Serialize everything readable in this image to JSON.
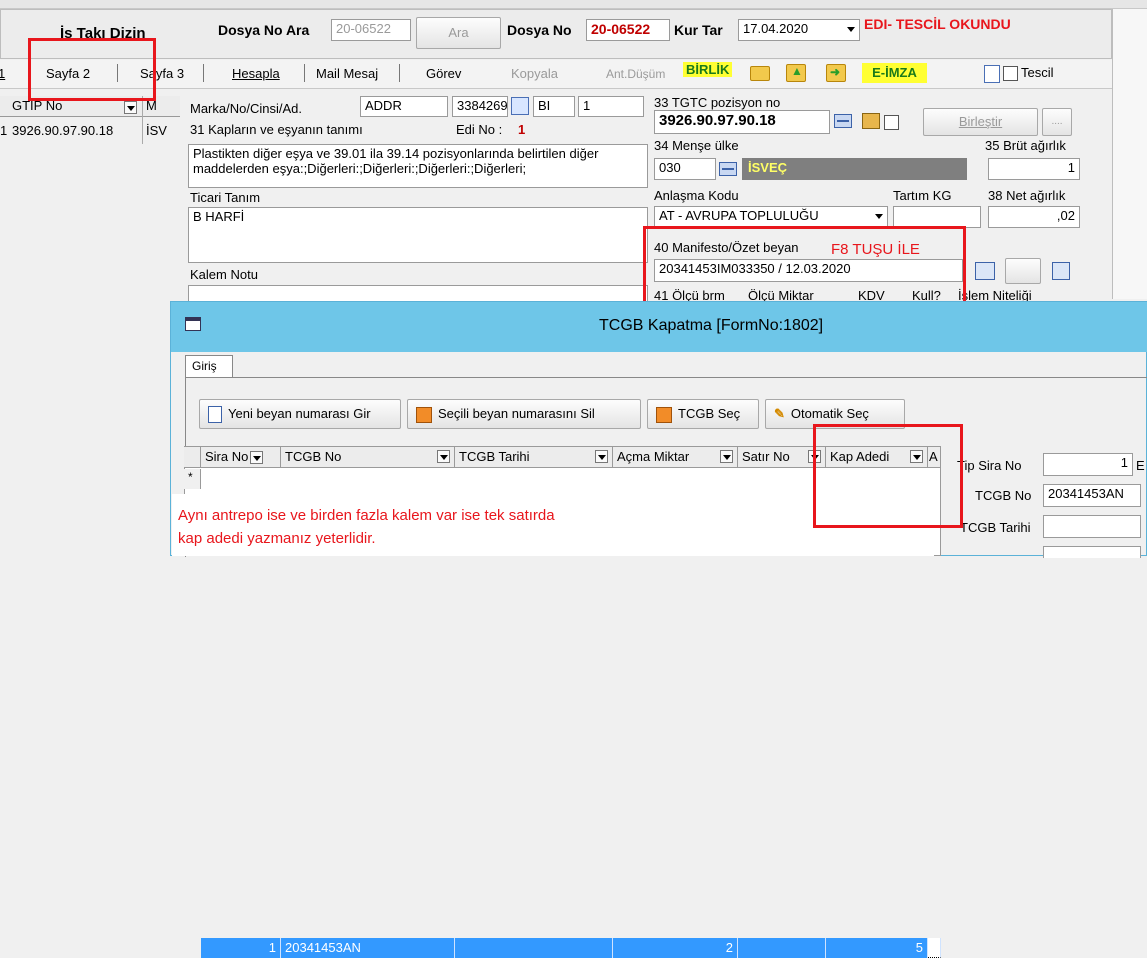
{
  "top": {
    "title_partial": "İş Takı Dizin",
    "dosya_no_ara_label": "Dosya No Ara",
    "dosya_no_ara_value": "20-06522",
    "ara_button": "Ara",
    "dosya_no_label": "Dosya No",
    "dosya_no_value": "20-06522",
    "kur_tar_label": "Kur Tar",
    "kur_tar_value": "17.04.2020",
    "edi_status": "EDI- TESCİL OKUNDU"
  },
  "tabs": [
    "1",
    "Sayfa 2",
    "Sayfa 3",
    "Hesapla",
    "Mail Mesaj",
    "Görev",
    "Kopyala",
    "Ant.Düşüm"
  ],
  "toolbar": {
    "birlik": "BİRLİK",
    "eimza": "E-İMZA",
    "tescil": "Tescil"
  },
  "left_grid": {
    "header": "GTIP No",
    "header2": "M",
    "row_prefix": "1",
    "row_value": "3926.90.97.90.18",
    "row_suffix": "İSV"
  },
  "form": {
    "marka_label": "Marka/No/Cinsi/Ad.",
    "marka_value1": "ADDR",
    "marka_value2": "3384269",
    "marka_value3": "BI",
    "marka_value4": "1",
    "kaplar_label": "31 Kapların ve eşyanın tanımı",
    "edi_no_label": "Edi No :",
    "edi_no_value": "1",
    "description": "Plastikten diğer eşya ve 39.01 ila 39.14 pozisyonlarında belirtilen diğer maddelerden eşya:;Diğerleri:;Diğerleri:;Diğerleri:;Diğerleri;",
    "ticari_label": "Ticari Tanım",
    "ticari_value": "B HARFİ",
    "kalem_notu_label": "Kalem Notu",
    "tgtc_label": "33 TGTC pozisyon no",
    "tgtc_value": "3926.90.97.90.18",
    "birlestir_button": "Birleştir",
    "dots_button": "....",
    "mense_label": "34 Menşe ülke",
    "brut_label": "35 Brüt ağırlık",
    "mense_code": "030",
    "mense_country": "İSVEÇ",
    "brut_value": "1",
    "anlasma_label": "Anlaşma Kodu",
    "tartim_label": "Tartım KG",
    "net_label": "38 Net ağırlık",
    "anlasma_value": "AT    - AVRUPA TOPLULUĞU",
    "net_value": ",02",
    "manifesto_label": "40 Manifesto/Özet beyan",
    "f8_note": "F8 TUŞU İLE",
    "manifesto_value": "20341453IM033350 / 12.03.2020",
    "olcu_label": "41 Ölçü brm",
    "olcu_miktar_label": "Ölçü Miktar",
    "kdv_label": "KDV",
    "kull_label": "Kull?",
    "islem_label": "İşlem Niteliği"
  },
  "dialog": {
    "title": "TCGB Kapatma [FormNo:1802]",
    "tab": "Giriş",
    "btn_new": "Yeni beyan numarası Gir",
    "btn_delete": "Seçili beyan numarasını Sil",
    "btn_select": "TCGB Seç",
    "btn_auto": "Otomatik Seç",
    "columns": [
      "Sira No",
      "TCGB No",
      "TCGB Tarihi",
      "Açma Miktar",
      "Satır No",
      "Kap Adedi",
      "A"
    ],
    "row": {
      "sira_no": "1",
      "tcgb_no": "20341453AN",
      "tcgb_tarihi": "",
      "acma_miktar": "2",
      "satir_no": "",
      "kap_adedi": "5"
    },
    "row_marker": "*",
    "side": {
      "tip_sira_label": "Tip Sira No",
      "tip_sira_value": "1",
      "tip_sira_extra": "E",
      "tcgb_no_label": "TCGB No",
      "tcgb_no_value": "20341453AN",
      "tcgb_tarihi_label": "TCGB Tarihi"
    }
  },
  "annotation": {
    "line1": "Aynı antrepo ise ve birden fazla kalem var ise tek satırda",
    "line2": "kap adedi yazmanız yeterlidir."
  },
  "colors": {
    "annotation_red": "#e8161c",
    "dialog_title_bar": "#6ec6e8",
    "selection_blue": "#3399ff",
    "dark_red": "#c00000"
  }
}
